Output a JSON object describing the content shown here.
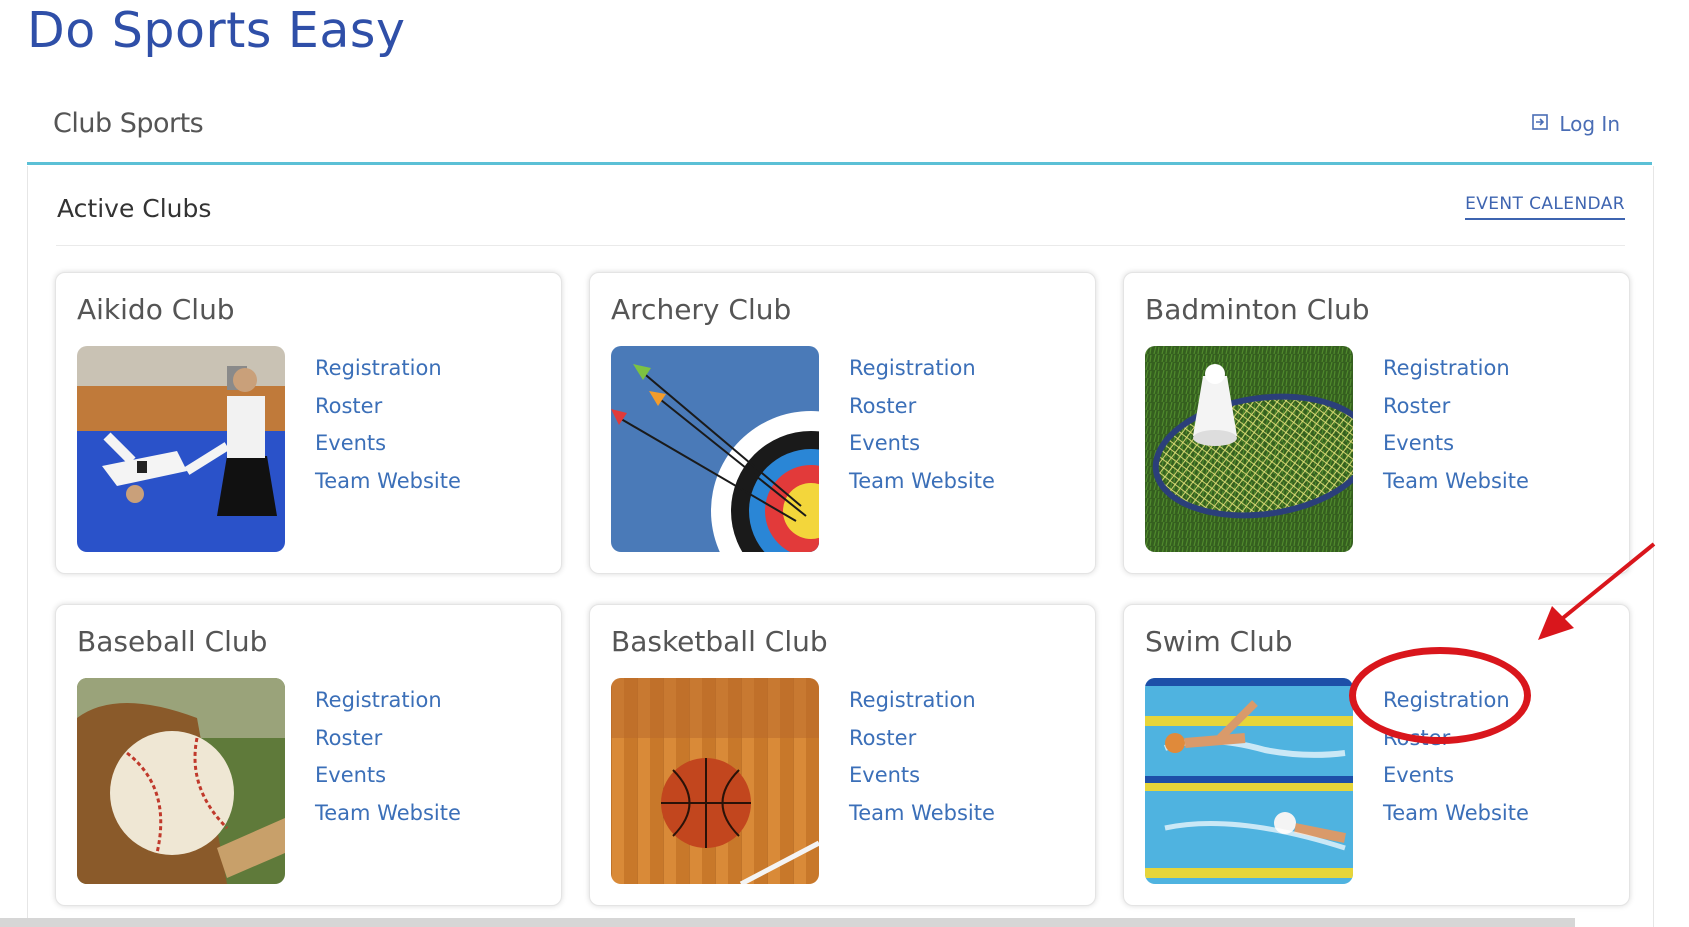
{
  "site": {
    "title": "Do Sports Easy"
  },
  "header": {
    "section": "Club Sports",
    "login_label": "Log In"
  },
  "panel": {
    "title": "Active Clubs",
    "calendar_label": "EVENT CALENDAR"
  },
  "clubs": [
    {
      "name": "Aikido Club",
      "links": [
        "Registration",
        "Roster",
        "Events",
        "Team Website"
      ]
    },
    {
      "name": "Archery Club",
      "links": [
        "Registration",
        "Roster",
        "Events",
        "Team Website"
      ]
    },
    {
      "name": "Badminton Club",
      "links": [
        "Registration",
        "Roster",
        "Events",
        "Team Website"
      ]
    },
    {
      "name": "Baseball Club",
      "links": [
        "Registration",
        "Roster",
        "Events",
        "Team Website"
      ]
    },
    {
      "name": "Basketball Club",
      "links": [
        "Registration",
        "Roster",
        "Events",
        "Team Website"
      ]
    },
    {
      "name": "Swim Club",
      "links": [
        "Registration",
        "Roster",
        "Events",
        "Team Website"
      ]
    }
  ],
  "icons": {
    "login": "login-icon",
    "annotation": "arrow-icon"
  },
  "colors": {
    "brand": "#2f4fa8",
    "link": "#3b6fb8",
    "accent_line": "#5bc0d6",
    "annotation": "#d9161c"
  }
}
